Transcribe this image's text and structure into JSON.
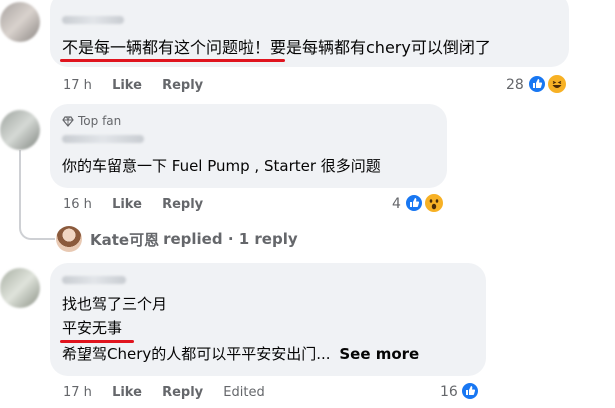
{
  "comments": [
    {
      "text": "不是每一辆都有这个问题啦！要是每辆都有chery可以倒闭了",
      "time": "17 h",
      "like_label": "Like",
      "reply_label": "Reply",
      "reaction_count": "28",
      "reaction_icons": [
        "like-icon",
        "haha-icon"
      ]
    },
    {
      "badge_icon": "diamond-icon",
      "badge": "Top fan",
      "text": "你的车留意一下 Fuel Pump , Starter 很多问题",
      "time": "16 h",
      "like_label": "Like",
      "reply_label": "Reply",
      "reaction_count": "4",
      "reaction_icons": [
        "like-icon",
        "wow-icon"
      ],
      "replies_summary": {
        "name": "Kate可恩",
        "text": "replied · 1 reply"
      }
    },
    {
      "lines": [
        "找也驾了三个月",
        "平安无事",
        "希望驾Chery的人都可以平平安安出门..."
      ],
      "see_more": "See more",
      "time": "17 h",
      "like_label": "Like",
      "reply_label": "Reply",
      "edited_label": "Edited",
      "reaction_count": "16",
      "reaction_icons": [
        "like-icon"
      ]
    }
  ],
  "colors": {
    "bubble": "#f0f2f5",
    "underline": "#e0141e",
    "like": "#1877f2",
    "haha": "#f7b125",
    "meta": "#65676b"
  }
}
